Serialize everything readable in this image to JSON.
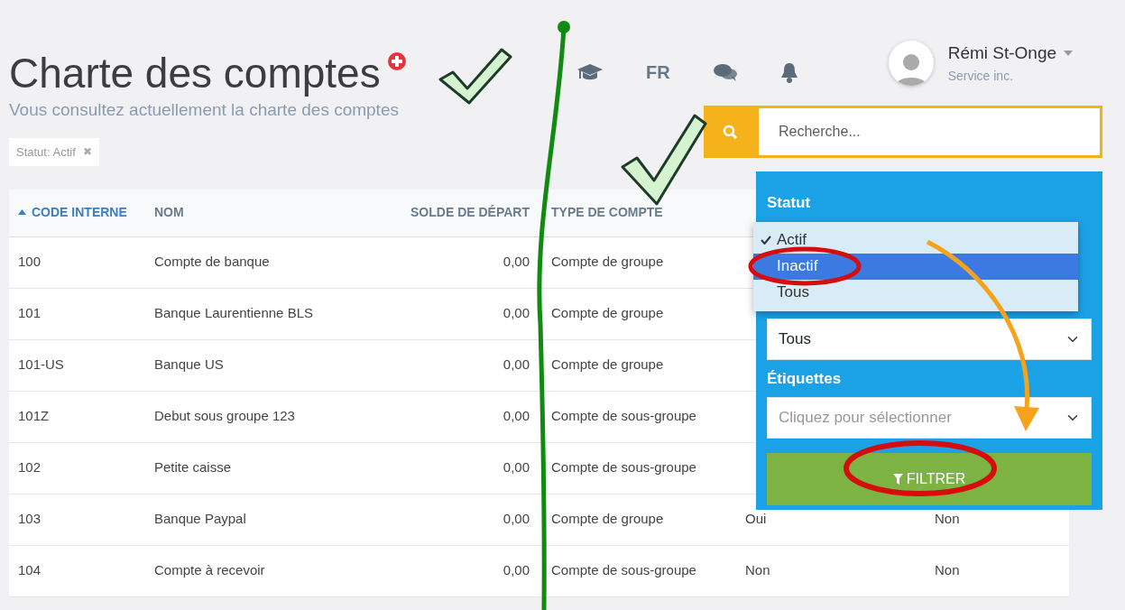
{
  "page": {
    "title": "Charte des comptes",
    "subtitle": "Vous consultez actuellement la charte des comptes",
    "filter_chip": "Statut: Actif",
    "chip_remove": "✖"
  },
  "topbar": {
    "language": "FR",
    "user": {
      "name": "Rémi St-Onge",
      "company": "Service inc."
    }
  },
  "search": {
    "placeholder": "Recherche..."
  },
  "table": {
    "columns": [
      {
        "label": "CODE INTERNE",
        "sorted": true
      },
      {
        "label": "NOM",
        "sorted": false
      },
      {
        "label": "SOLDE DE DÉPART",
        "sorted": false
      },
      {
        "label": "TYPE DE COMPTE",
        "sorted": false
      }
    ],
    "rows": [
      {
        "code": "100",
        "name": "Compte de banque",
        "opening_balance": "0,00",
        "type": "Compte de groupe"
      },
      {
        "code": "101",
        "name": "Banque Laurentienne BLS",
        "opening_balance": "0,00",
        "type": "Compte de groupe"
      },
      {
        "code": "101-US",
        "name": "Banque US",
        "opening_balance": "0,00",
        "type": "Compte de groupe"
      },
      {
        "code": "101Z",
        "name": "Debut sous groupe 123",
        "opening_balance": "0,00",
        "type": "Compte de sous-groupe"
      },
      {
        "code": "102",
        "name": "Petite caisse",
        "opening_balance": "0,00",
        "type": "Compte de sous-groupe"
      },
      {
        "code": "103",
        "name": "Banque Paypal",
        "opening_balance": "0,00",
        "type": "Compte de groupe",
        "column_5": "Oui",
        "column_6": "Non"
      },
      {
        "code": "104",
        "name": "Compte à recevoir",
        "opening_balance": "0,00",
        "type": "Compte de sous-groupe",
        "column_5": "Non",
        "column_6": "Non"
      }
    ]
  },
  "filter_panel": {
    "status_label": "Statut",
    "status_options": [
      {
        "label": "Actif",
        "selected": true,
        "highlighted": false
      },
      {
        "label": "Inactif",
        "selected": false,
        "highlighted": true
      },
      {
        "label": "Tous",
        "selected": false,
        "highlighted": false
      }
    ],
    "second_select_value": "Tous",
    "tags_label": "Étiquettes",
    "tags_placeholder": "Cliquez pour sélectionner",
    "filter_button": "FILTRER"
  }
}
